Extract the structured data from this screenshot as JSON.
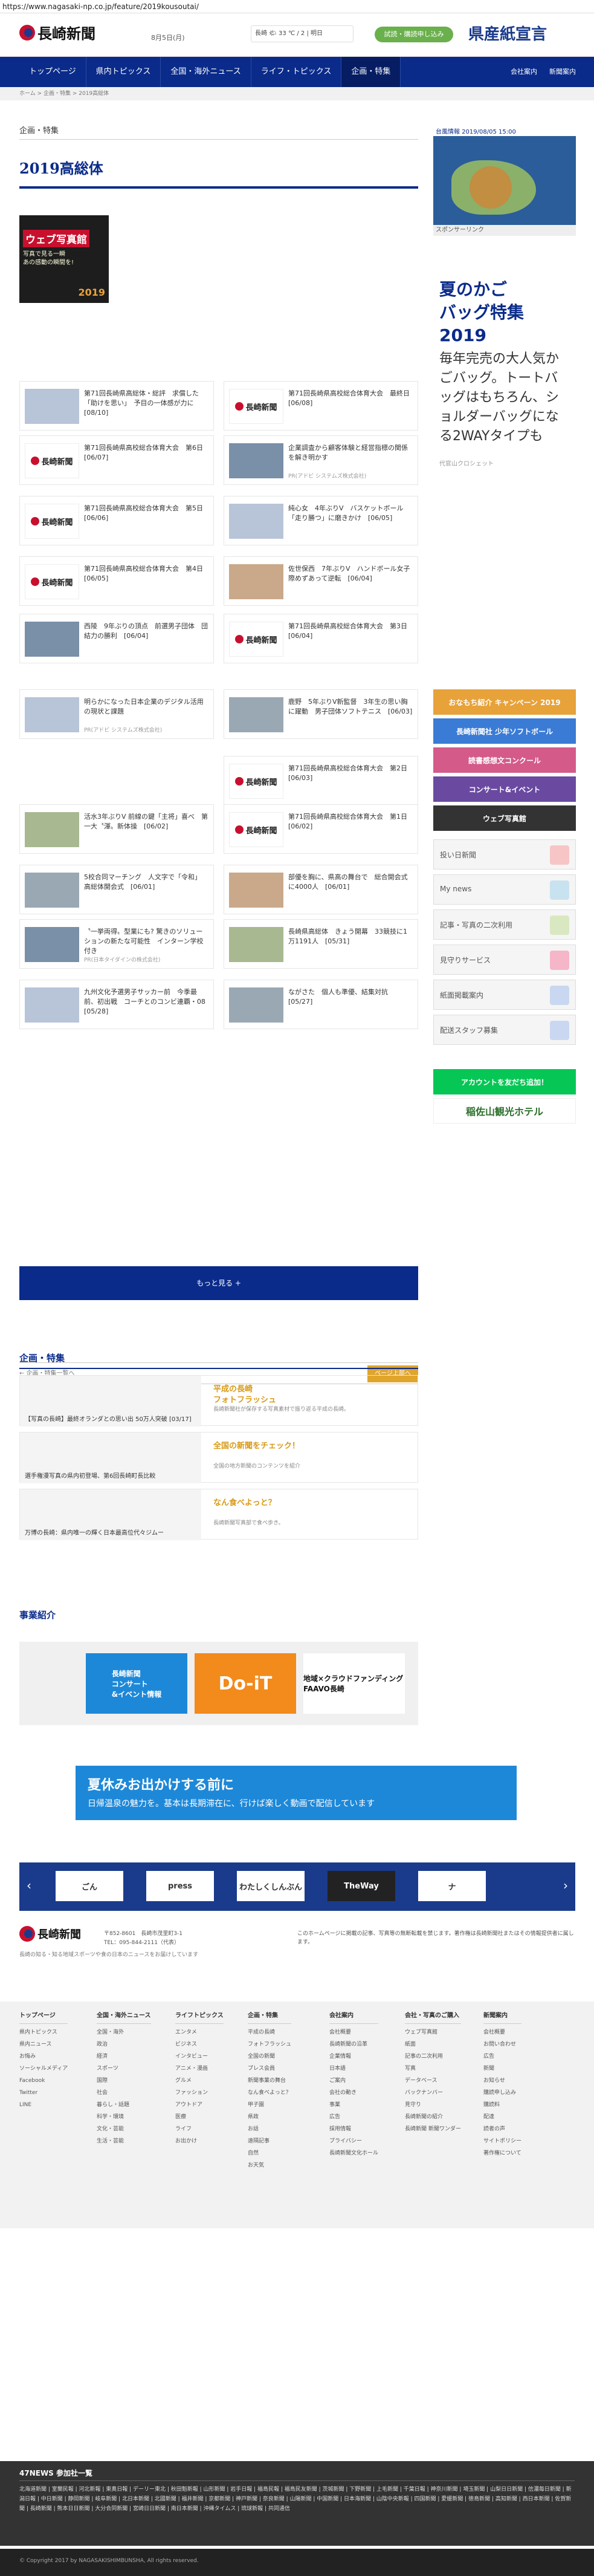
{
  "url": "https://www.nagasaki-np.co.jp/feature/2019kousoutai/",
  "header": {
    "logo": "長崎新聞",
    "date": "8月5日(月)",
    "weather": "長崎 🌤 33 ℃ / 2 | 明日",
    "trial_button": "試読・購読申し込み",
    "kensan": "県産紙宣言"
  },
  "nav": {
    "items": [
      "トップページ",
      "県内トピックス",
      "全国・海外ニュース",
      "ライフ・トピックス",
      "企画・特集"
    ],
    "right": [
      "会社案内",
      "新聞案内"
    ]
  },
  "breadcrumb": "ホーム > 企画・特集 > 2019高総体",
  "section_label": "企画・特集",
  "page_title": "2019高総体",
  "banner": {
    "title": "ウェブ写真館",
    "sub1": "写真で見る一瞬",
    "sub2": "あの感動の瞬間を!",
    "year": "2019"
  },
  "articles": [
    {
      "text": "第71回長崎県高総体・総評　求償した「助けを思い」　予目の一体感が力に　[08/10]",
      "logo": false
    },
    {
      "text": "第71回長崎県高校総合体育大会　最終日　[06/08]",
      "logo": true
    },
    {
      "text": "第71回長崎県高校総合体育大会　第6日　[06/07]",
      "logo": true
    },
    {
      "text": "企業調査から顧客体験と経営指標の関係を解き明かす",
      "sub": "PR(アドビ システムズ株式会社)",
      "logo": false
    },
    {
      "text": "第71回長崎県高校総合体育大会　第5日　[06/06]",
      "logo": true
    },
    {
      "text": "純心女　4年ぶりV　バスケットボール「走り勝つ」に磨きかけ　[06/05]",
      "logo": false
    },
    {
      "text": "第71回長崎県高校総合体育大会　第4日　[06/05]",
      "logo": true
    },
    {
      "text": "佐世保西　7年ぶりV　ハンドボール女子　際めずあって逆転　[06/04]",
      "logo": false
    },
    {
      "text": "西陵　9年ぶりの頂点　前選男子団体　団結力の勝利　[06/04]",
      "logo": false
    },
    {
      "text": "第71回長崎県高校総合体育大会　第3日　[06/04]",
      "logo": true
    },
    {
      "text": "明らかになった日本企業のデジタル活用の現状と課題",
      "sub": "PR(アドビ システムズ株式会社)",
      "logo": false
    },
    {
      "text": "鹿野　5年ぶりV新監督　3年生の思い胸に躍動　男子団体ソフトテニス　[06/03]",
      "logo": false
    },
    {
      "text": "",
      "logo": false,
      "empty": true
    },
    {
      "text": "第71回長崎県高校総合体育大会　第2日　[06/03]",
      "logo": true
    },
    {
      "text": "活水3年ぶりV 前線の鍵「主将」喜べ　第一大〝渾〟新体操　[06/02]",
      "logo": false
    },
    {
      "text": "第71回長崎県高校総合体育大会　第1日　[06/02]",
      "logo": true
    },
    {
      "text": "5校合同マーチング　人文字で「令和」 高総体開会式　[06/01]",
      "logo": false
    },
    {
      "text": "部優を胸に、県高の舞台で　総合開会式に4000人　[06/01]",
      "logo": false
    },
    {
      "text": "〝一挙両得〟型業にも? 驚きのソリューションの新たな可能性　インターン学校付き",
      "sub": "PR(日本タイダインの株式会社)",
      "logo": false
    },
    {
      "text": "長崎県高総体　きょう開幕　33競技に1万1191人　[05/31]",
      "logo": false
    },
    {
      "text": "九州文化予選男子サッカー前　今季最前、初出戦　コーチとのコンビ連覇・08　[05/28]",
      "logo": false
    },
    {
      "text": "ながさた　個人も準優、結集対抗　[05/27]",
      "logo": false
    }
  ],
  "more_button": "もっと見る +",
  "back_bar": {
    "left": "← 企画・特集一覧へ",
    "right": "ページ上部へ"
  },
  "features": {
    "heading": "企画・特集",
    "items": [
      {
        "left": "【写真の長崎】最終オランダとの思い出 50万人突破 [03/17]",
        "title": "平成の長崎\nフォトフラッシュ",
        "sub": "長崎新聞社が保存する写真素材で振り返る平成の長崎。"
      },
      {
        "left": "選手権漫写真の県内初登場、第6回長崎町長比較",
        "title": "全国の新聞をチェック！",
        "sub": "全国の地方新聞のコンテンツを紹介"
      },
      {
        "left": "万博の長崎：県内唯一の輝く日本最高位代々ジムー",
        "title": "なん食べよっと？",
        "sub": "長崎新聞写真部で食べ歩き。"
      }
    ]
  },
  "business": {
    "heading": "事業紹介",
    "items": [
      "長崎新聞\nコンサート\n&イベント情報",
      "Do-iT",
      "地域×クラウドファンディング FAAVO長崎"
    ]
  },
  "sidebar": {
    "map_header": "台風情報",
    "map_time": "2019/08/05 15:00",
    "map_footer": "スポンサーリンク",
    "ad_title": "夏のかご\nバッグ特集\n2019",
    "ad_text": "毎年完売の大人気かごバッグ。トートバッグはもちろん、ショルダーバッグになる2WAYタイプも",
    "ad_credit": "代官山クロシェット",
    "boxes": [
      "投い日新聞",
      "My news",
      "記事・写真の二次利用",
      "見守りサービス",
      "紙面掲載案内",
      "配送スタッフ募集"
    ],
    "box_colors": [
      "#f7c5c5",
      "#c9e2f0",
      "#d9e8c0",
      "#f4b6c8",
      "#c9d8f0",
      "#c9d8f0"
    ],
    "promos": [
      "おなもち紹介 キャンペーン 2019",
      "長崎新聞社 少年ソフトボール",
      "読書感想文コンクール",
      "コンサート&イベント",
      "ウェブ写真館"
    ],
    "line_btn": "アカウントを友だち追加！",
    "hotel": "稲佐山観光ホテル"
  },
  "bottom_banner": {
    "title": "夏休みお出かけする前に",
    "text": "日帰温泉の魅力を。基本は長期滞在に、行けば楽しく動画で配信しています"
  },
  "carousel": [
    "ごん",
    "press",
    "わたしくしんぶん",
    "TheWay",
    "ナ"
  ],
  "footer": {
    "logo": "長崎新聞",
    "addr": "〒852-8601　長崎市茂里町3-1\nTEL：095-844-2111（代表）",
    "desc": "長崎の知る・知る地域スポーツや食の日本のニュースをお届けしています",
    "note": "このホームページに掲載の記事、写真等の無断転載を禁じます。著作権は長崎新聞社またはその情報提供者に属します。"
  },
  "footer_links": [
    {
      "head": "トップページ",
      "items": [
        "県内トピックス",
        "県内ニュース",
        "お悔み",
        "ソーシャルメディア",
        "Facebook",
        "Twitter",
        "LINE"
      ]
    },
    {
      "head": "全国・海外ニュース",
      "items": [
        "全国・海外",
        "政治",
        "経済",
        "スポーツ",
        "国際",
        "社会",
        "暮らし・話題",
        "科学・環境",
        "文化・芸能",
        "生活・芸能"
      ]
    },
    {
      "head": "ライフトピックス",
      "items": [
        "エンタメ",
        "ビジネス",
        "インタビュー",
        "アニメ・漫画",
        "グルメ",
        "ファッション",
        "アウトドア",
        "医療",
        "ライフ",
        "お出かけ"
      ]
    },
    {
      "head": "企画・特集",
      "items": [
        "平成の長崎",
        "フォトフラッシュ",
        "全国の新聞",
        "プレス会員",
        "新聞事業の舞台",
        "なん食べよっと？",
        "甲子園",
        "県政",
        "お話",
        "遠隔記事",
        "自然",
        "お天気"
      ]
    },
    {
      "head": "会社案内",
      "items": [
        "会社概要",
        "長崎新聞の沿革",
        "企業情報",
        "日本語",
        "ご案内",
        "会社の動き",
        "事業",
        "広告",
        "採用情報",
        "プライバシー",
        "長崎新聞文化ホール"
      ]
    },
    {
      "head": "会社・写真のご購入",
      "items": [
        "ウェブ写真館",
        "紙面",
        "記事の二次利用",
        "写真",
        "データベース",
        "バックナンバー",
        "見守り",
        "長崎新聞の紹介",
        "長崎新聞 新聞ワンダー"
      ]
    },
    {
      "head": "新聞案内",
      "items": [
        "会社概要",
        "お問い合わせ",
        "広告",
        "新聞",
        "お知らせ",
        "購読申し込み",
        "購読料",
        "配達",
        "読者の声",
        "サイトポリシー",
        "著作権について"
      ]
    }
  ],
  "news47": {
    "heading": "47NEWS 参加社一覧",
    "text": "北海道新聞 | 室蘭民報 | 河北新報 | 東奥日報 | デーリー東北 | 秋田魁新報 | 山形新聞 | 岩手日報 | 福島民報 | 福島民友新聞 | 茨城新聞 | 下野新聞 | 上毛新聞 | 千葉日報 | 神奈川新聞 | 埼玉新聞 | 山梨日日新聞 | 信濃毎日新聞 | 新潟日報 | 中日新聞 | 静岡新聞 | 岐阜新聞 | 北日本新聞 | 北國新聞 | 福井新聞 | 京都新聞 | 神戸新聞 | 奈良新聞 | 山陽新聞 | 中国新聞 | 日本海新聞 | 山陰中央新報 | 四国新聞 | 愛媛新聞 | 徳島新聞 | 高知新聞 | 西日本新聞 | 佐賀新聞 | 長崎新聞 | 熊本日日新聞 | 大分合同新聞 | 宮崎日日新聞 | 南日本新聞 | 沖縄タイムス | 琉球新報 | 共同通信"
  },
  "copyright": "© Copyright 2017 by NAGASAKISHIMBUNSHA, All rights reserved."
}
